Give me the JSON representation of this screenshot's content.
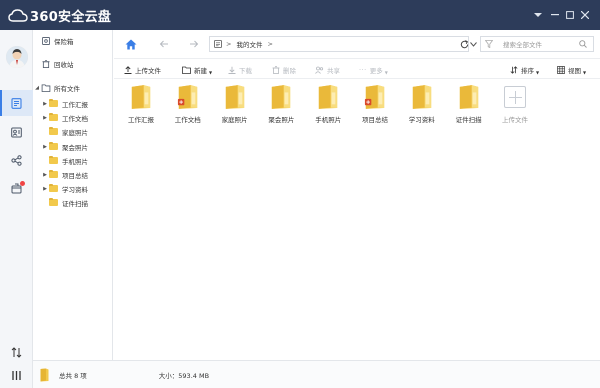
{
  "app": {
    "title": "360安全云盘",
    "menu_icon": "chevron-down",
    "min_icon": "minimize",
    "max_icon": "maximize",
    "close_icon": "close"
  },
  "rail": {
    "items": [
      {
        "name": "files",
        "icon": "document-icon",
        "active": true
      },
      {
        "name": "contacts",
        "icon": "contacts-icon"
      },
      {
        "name": "share",
        "icon": "share-icon"
      },
      {
        "name": "box",
        "icon": "box-icon",
        "badge": true
      },
      {
        "name": "transfer",
        "icon": "transfer-icon"
      },
      {
        "name": "menu",
        "icon": "menu-icon"
      }
    ]
  },
  "tree": {
    "safe": "保险箱",
    "recycle": "回收站",
    "all_files": "所有文件",
    "folders": [
      "工作汇报",
      "工作文档",
      "家庭照片",
      "聚会照片",
      "手机照片",
      "项目总结",
      "学习资料",
      "证件扫描"
    ],
    "expandable": [
      true,
      true,
      false,
      true,
      false,
      true,
      true,
      false
    ]
  },
  "nav": {
    "breadcrumb_root": "我的文件",
    "breadcrumb_sep": ">",
    "search_placeholder": "搜索全部文件"
  },
  "toolbar": {
    "upload": "上传文件",
    "new": "新建",
    "download": "下载",
    "delete": "删除",
    "share": "共享",
    "more": "更多",
    "sort": "排序",
    "view": "视图"
  },
  "files": [
    {
      "name": "工作汇报",
      "badge": false
    },
    {
      "name": "工作文档",
      "badge": true
    },
    {
      "name": "家庭照片",
      "badge": false
    },
    {
      "name": "聚会照片",
      "badge": false
    },
    {
      "name": "手机照片",
      "badge": false
    },
    {
      "name": "项目总结",
      "badge": true
    },
    {
      "name": "学习资料",
      "badge": false
    },
    {
      "name": "证件扫描",
      "badge": false
    }
  ],
  "upload_tile": "上传文件",
  "status": {
    "count": "总共 8 项",
    "size": "大小：593.4 MB"
  },
  "colors": {
    "titlebar": "#2d3c5a",
    "accent": "#3a7ee6",
    "folder": "#f2c94c"
  }
}
